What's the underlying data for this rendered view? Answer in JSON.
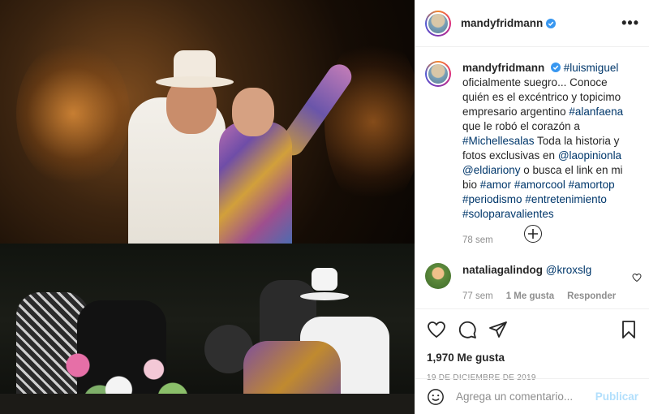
{
  "post": {
    "username": "mandyfridmann",
    "more_label": "•••",
    "caption": {
      "username": "mandyfridmann",
      "parts": [
        {
          "t": "#luismiguel",
          "link": true
        },
        {
          "t": " oficialmente suegro... Conoce quién es el excéntrico y topicimo empresario argentino ",
          "link": false
        },
        {
          "t": "#alanfaena",
          "link": true
        },
        {
          "t": " que le robó el corazón a ",
          "link": false
        },
        {
          "t": "#Michellesalas",
          "link": true
        },
        {
          "t": " Toda la historia y fotos exclusivas en ",
          "link": false
        },
        {
          "t": "@laopinionla",
          "link": true
        },
        {
          "t": " ",
          "link": false
        },
        {
          "t": "@eldiariony",
          "link": true
        },
        {
          "t": " o busca el link en mi bio ",
          "link": false
        },
        {
          "t": "#amor",
          "link": true
        },
        {
          "t": " ",
          "link": false
        },
        {
          "t": "#amorcool",
          "link": true
        },
        {
          "t": " ",
          "link": false
        },
        {
          "t": "#amortop",
          "link": true
        },
        {
          "t": " ",
          "link": false
        },
        {
          "t": "#periodismo",
          "link": true
        },
        {
          "t": " ",
          "link": false
        },
        {
          "t": "#entretenimiento",
          "link": true
        },
        {
          "t": " ",
          "link": false
        },
        {
          "t": "#soloparavalientes",
          "link": true
        }
      ],
      "time": "78 sem"
    },
    "comment": {
      "username": "nataliagalindog",
      "mention": "@kroxslg",
      "time": "77 sem",
      "likes": "1 Me gusta",
      "reply": "Responder"
    },
    "likes": "1,970 Me gusta",
    "date": "19 DE DICIEMBRE DE 2019",
    "add_comment_placeholder": "Agrega un comentario...",
    "publish_label": "Publicar"
  },
  "colors": {
    "link": "#00376b",
    "verified": "#3897f0",
    "muted": "#8e8e8e",
    "publish_disabled": "#b2dffc"
  },
  "icons": [
    "verified-badge-icon",
    "more-options-icon",
    "load-more-comments-icon",
    "heart-icon",
    "comment-icon",
    "share-icon",
    "save-bookmark-icon",
    "emoji-icon"
  ]
}
